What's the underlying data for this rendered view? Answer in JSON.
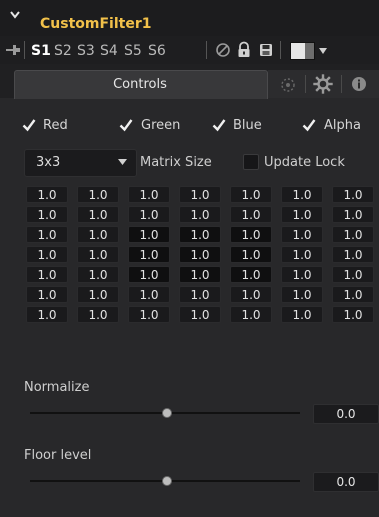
{
  "header": {
    "title": "CustomFilter1"
  },
  "toolbar": {
    "slots": [
      "S1",
      "S2",
      "S3",
      "S4",
      "S5",
      "S6"
    ],
    "active_slot": "S1",
    "icons": [
      "pin-icon",
      "disable-icon",
      "lock-icon",
      "save-icon",
      "color-swatch-icon",
      "chevron-down-icon"
    ]
  },
  "tabs": {
    "controls_label": "Controls",
    "other_icons": [
      "modifier-icon",
      "settings-gear-icon",
      "info-icon"
    ]
  },
  "channels": [
    {
      "label": "Red",
      "checked": true
    },
    {
      "label": "Green",
      "checked": true
    },
    {
      "label": "Blue",
      "checked": true
    },
    {
      "label": "Alpha",
      "checked": true
    }
  ],
  "matrix": {
    "size_value": "3x3",
    "size_label": "Matrix Size",
    "update_lock_label": "Update Lock",
    "update_lock_checked": false,
    "rows": [
      [
        "1.0",
        "1.0",
        "1.0",
        "1.0",
        "1.0",
        "1.0",
        "1.0"
      ],
      [
        "1.0",
        "1.0",
        "1.0",
        "1.0",
        "1.0",
        "1.0",
        "1.0"
      ],
      [
        "1.0",
        "1.0",
        "1.0",
        "1.0",
        "1.0",
        "1.0",
        "1.0"
      ],
      [
        "1.0",
        "1.0",
        "1.0",
        "1.0",
        "1.0",
        "1.0",
        "1.0"
      ],
      [
        "1.0",
        "1.0",
        "1.0",
        "1.0",
        "1.0",
        "1.0",
        "1.0"
      ],
      [
        "1.0",
        "1.0",
        "1.0",
        "1.0",
        "1.0",
        "1.0",
        "1.0"
      ],
      [
        "1.0",
        "1.0",
        "1.0",
        "1.0",
        "1.0",
        "1.0",
        "1.0"
      ]
    ]
  },
  "normalize": {
    "label": "Normalize",
    "value": "0.0"
  },
  "floor_level": {
    "label": "Floor level",
    "value": "0.0"
  },
  "colors": {
    "accent_title": "#f2c14a",
    "panel_bg": "#28282a"
  }
}
